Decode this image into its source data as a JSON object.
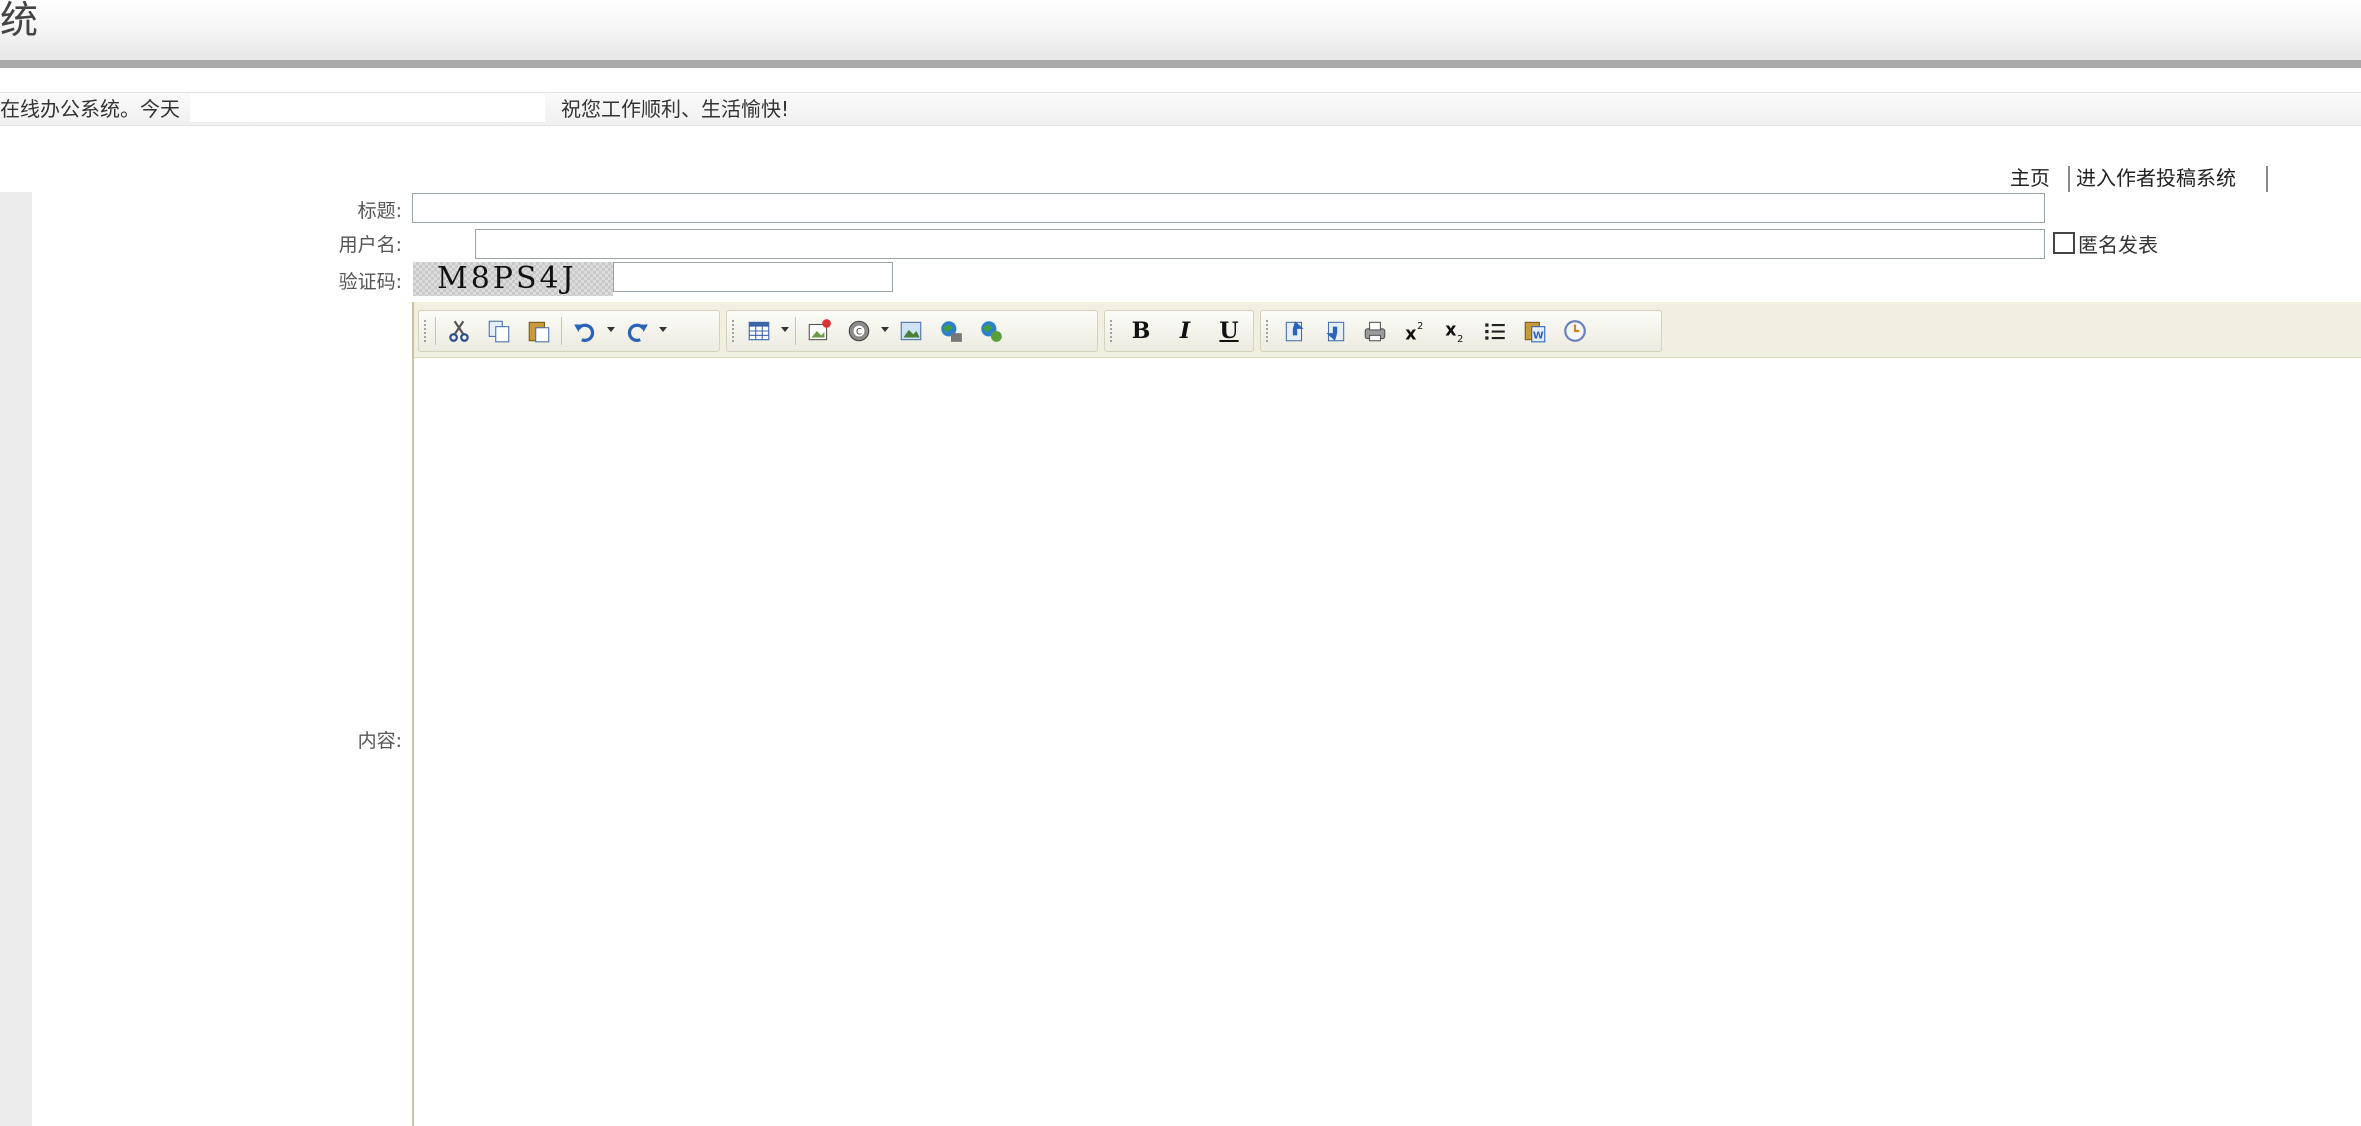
{
  "header": {
    "app_title": "统"
  },
  "infobar": {
    "welcome": "在线办公系统。今天",
    "wish": "祝您工作顺利、生活愉快!"
  },
  "nav": {
    "home": "主页",
    "author_system": "进入作者投稿系统"
  },
  "form": {
    "title_label": "标题:",
    "username_label": "用户名:",
    "captcha_label": "验证码:",
    "captcha_text": "M8PS4J",
    "content_label": "内容:",
    "anonymous_label": "匿名发表",
    "title_value": "",
    "username_value": "",
    "captcha_value": ""
  },
  "toolbar": {
    "bold": "B",
    "italic": "I",
    "underline": "U",
    "icons": [
      "cut-icon",
      "copy-icon",
      "paste-icon",
      "undo-icon",
      "redo-icon",
      "table-icon",
      "image-map-icon",
      "emoticon-icon",
      "image-icon",
      "media-icon",
      "flash-icon",
      "bold-icon",
      "italic-icon",
      "underline-icon",
      "align-left-icon",
      "align-right-icon",
      "print-icon",
      "superscript-icon",
      "subscript-icon",
      "list-icon",
      "paste-word-icon",
      "time-icon"
    ]
  }
}
